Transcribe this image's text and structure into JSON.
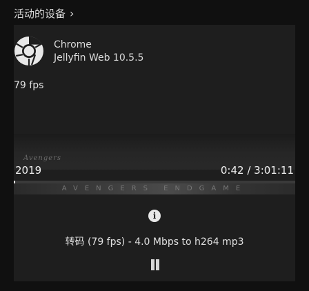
{
  "header": {
    "title": "活动的设备",
    "chevron": "›"
  },
  "session": {
    "client_name": "Chrome",
    "client_version": "Jellyfin Web 10.5.5",
    "client_icon": "chrome-icon",
    "fps": "79 fps",
    "media": {
      "logo_text": "Avengers",
      "banner_text": "AVENGERS ENDGAME",
      "year": "2019",
      "time": "0:42 / 3:01:11",
      "progress": 0.0039
    },
    "transcode_info": "转码 (79 fps) - 4.0 Mbps to h264 mp3",
    "info_icon": "info-icon",
    "pause_icon": "pause-icon"
  },
  "colors": {
    "background": "#101010",
    "card": "#1e1e1e",
    "text": "#e6e6e6",
    "progress_fill": "#e0e0e0"
  }
}
